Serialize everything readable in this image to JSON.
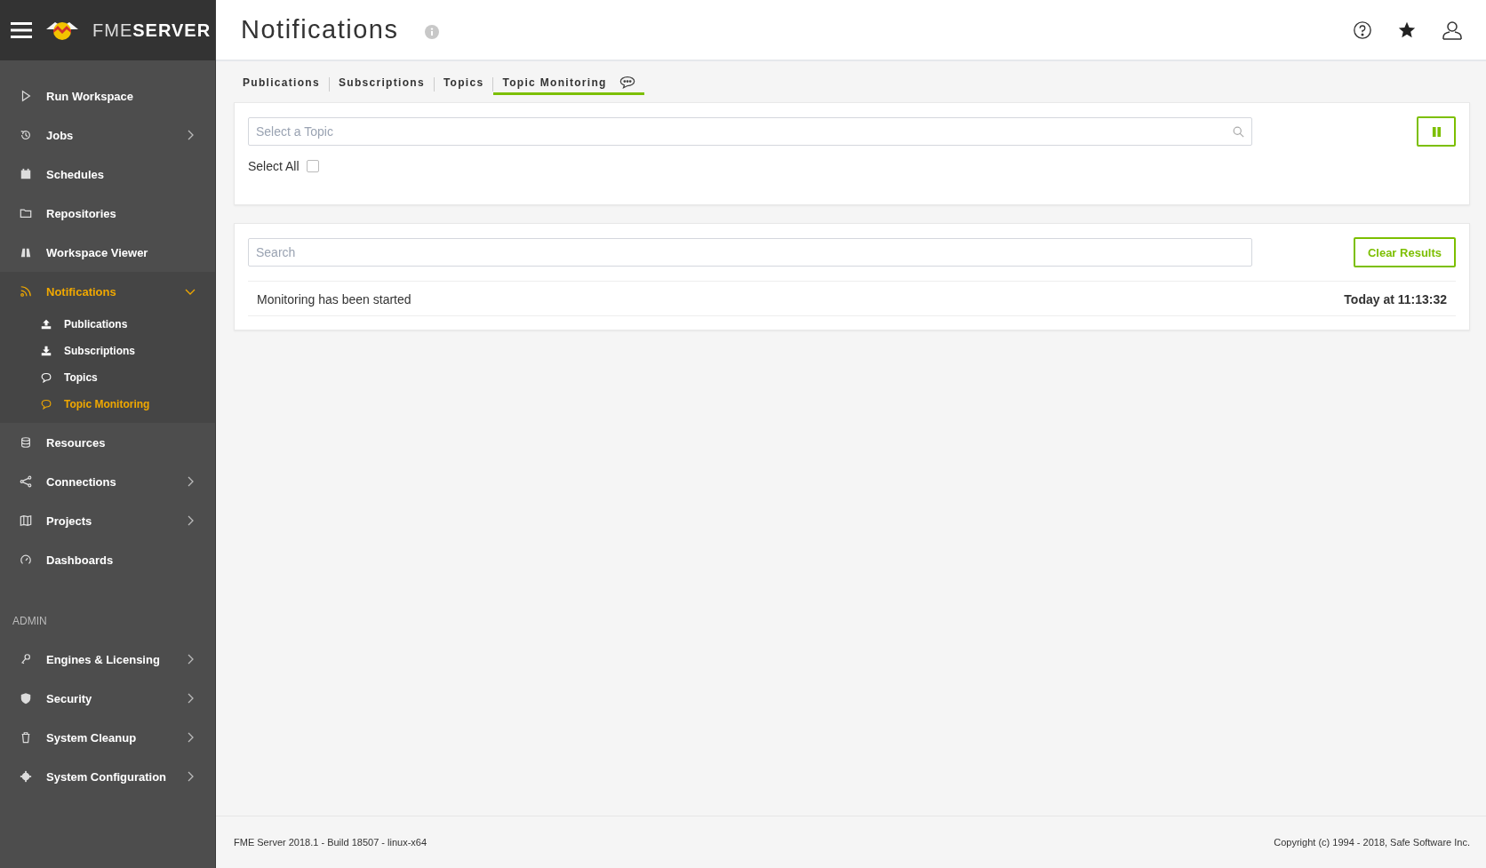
{
  "sidebar": {
    "logo": {
      "light": "FME",
      "bold": "SERVER"
    },
    "items": [
      {
        "label": "Run Workspace",
        "kind": "link",
        "selected": false
      },
      {
        "label": "Jobs",
        "kind": "menu",
        "expanded": false,
        "selected": false
      },
      {
        "label": "Schedules",
        "kind": "link",
        "selected": false
      },
      {
        "label": "Repositories",
        "kind": "link",
        "selected": false
      },
      {
        "label": "Workspace Viewer",
        "kind": "link",
        "selected": false
      },
      {
        "label": "Notifications",
        "kind": "menu",
        "expanded": true,
        "selected": true,
        "children": [
          {
            "label": "Publications",
            "selected": false
          },
          {
            "label": "Subscriptions",
            "selected": false
          },
          {
            "label": "Topics",
            "selected": false
          },
          {
            "label": "Topic Monitoring",
            "selected": true
          }
        ]
      },
      {
        "label": "Resources",
        "kind": "link",
        "selected": false
      },
      {
        "label": "Connections",
        "kind": "menu",
        "expanded": false,
        "selected": false
      },
      {
        "label": "Projects",
        "kind": "menu",
        "expanded": false,
        "selected": false
      },
      {
        "label": "Dashboards",
        "kind": "link",
        "selected": false
      }
    ],
    "admin_heading": "ADMIN",
    "admin_items": [
      {
        "label": "Engines & Licensing",
        "kind": "menu",
        "expanded": false,
        "selected": false
      },
      {
        "label": "Security",
        "kind": "menu",
        "expanded": false,
        "selected": false
      },
      {
        "label": "System Cleanup",
        "kind": "menu",
        "expanded": false,
        "selected": false
      },
      {
        "label": "System Configuration",
        "kind": "menu",
        "expanded": false,
        "selected": false
      }
    ]
  },
  "header": {
    "title": "Notifications"
  },
  "tabs": [
    {
      "label": "Publications",
      "selected": false
    },
    {
      "label": "Subscriptions",
      "selected": false
    },
    {
      "label": "Topics",
      "selected": false
    },
    {
      "label": "Topic Monitoring",
      "selected": true
    }
  ],
  "topic_panel": {
    "topic_field": {
      "placeholder": "Select a Topic"
    },
    "select_all": {
      "label": "Select All",
      "checked": false
    }
  },
  "results_panel": {
    "search": {
      "placeholder": "Search"
    },
    "clear_button": "Clear Results",
    "messages": [
      {
        "text": "Monitoring has been started",
        "time": "Today at 11:13:32"
      }
    ]
  },
  "footer": {
    "version": "FME Server 2018.1 - Build 18507 - linux-x64",
    "copyright": "Copyright (c) 1994 - 2018, Safe Software Inc."
  }
}
